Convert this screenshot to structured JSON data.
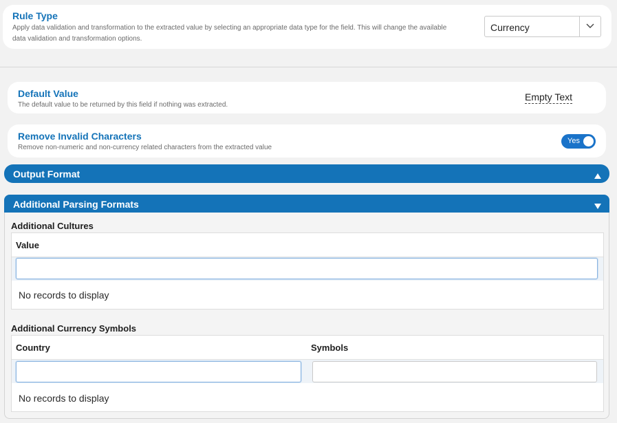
{
  "rule_type": {
    "title": "Rule Type",
    "description": "Apply data validation and transformation to the extracted value by selecting an appropriate data type for the field. This will change the available data validation and transformation options.",
    "selected": "Currency"
  },
  "default_value": {
    "title": "Default Value",
    "description": "The default value to be returned by this field if nothing was extracted.",
    "value": "Empty Text"
  },
  "remove_invalid": {
    "title": "Remove Invalid Characters",
    "description": "Remove non-numeric and non-currency related characters from the extracted value",
    "toggle_label": "Yes",
    "toggle_on": true
  },
  "output_format": {
    "title": "Output Format"
  },
  "additional_parsing": {
    "title": "Additional Parsing Formats",
    "cultures": {
      "title": "Additional Cultures",
      "columns": [
        "Value"
      ],
      "input_value": "",
      "empty_message": "No records to display"
    },
    "currency_symbols": {
      "title": "Additional Currency Symbols",
      "columns": [
        "Country",
        "Symbols"
      ],
      "country_value": "",
      "symbols_value": "",
      "empty_message": "No records to display"
    }
  },
  "colors": {
    "accent": "#1473b8",
    "toggle": "#1a73c9"
  }
}
